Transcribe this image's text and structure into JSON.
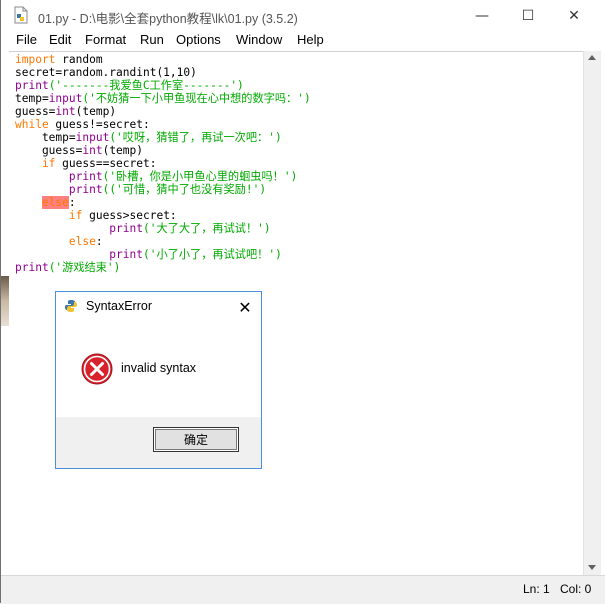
{
  "window": {
    "title": "01.py - D:\\电影\\全套python教程\\lk\\01.py (3.5.2)",
    "minimize_glyph": "—",
    "maximize_glyph": "☐",
    "close_glyph": "✕"
  },
  "menu": [
    "File",
    "Edit",
    "Format",
    "Run",
    "Options",
    "Window",
    "Help"
  ],
  "code_lines": [
    [
      {
        "t": "import",
        "c": "kw"
      },
      {
        "t": " random",
        "c": ""
      }
    ],
    [
      {
        "t": "secret=random.randint(1,10)",
        "c": ""
      }
    ],
    [
      {
        "t": "print",
        "c": "bi"
      },
      {
        "t": "('-------我爱鱼C工作室-------')",
        "c": "str"
      }
    ],
    [
      {
        "t": "temp=",
        "c": ""
      },
      {
        "t": "input",
        "c": "bi"
      },
      {
        "t": "('不妨猜一下小甲鱼现在心中想的数字吗：')",
        "c": "str"
      }
    ],
    [
      {
        "t": "guess=",
        "c": ""
      },
      {
        "t": "int",
        "c": "bi"
      },
      {
        "t": "(temp)",
        "c": ""
      }
    ],
    [
      {
        "t": "while",
        "c": "kw"
      },
      {
        "t": " guess!=secret:",
        "c": ""
      }
    ],
    [
      {
        "t": "    temp=",
        "c": ""
      },
      {
        "t": "input",
        "c": "bi"
      },
      {
        "t": "('哎呀，猜错了，再试一次吧：')",
        "c": "str"
      }
    ],
    [
      {
        "t": "    guess=",
        "c": ""
      },
      {
        "t": "int",
        "c": "bi"
      },
      {
        "t": "(temp)",
        "c": ""
      }
    ],
    [
      {
        "t": "    ",
        "c": ""
      },
      {
        "t": "if",
        "c": "kw"
      },
      {
        "t": " guess==secret:",
        "c": ""
      }
    ],
    [
      {
        "t": "        ",
        "c": ""
      },
      {
        "t": "print",
        "c": "bi"
      },
      {
        "t": "('卧槽，你是小甲鱼心里的蛔虫吗！')",
        "c": "str"
      }
    ],
    [
      {
        "t": "        ",
        "c": ""
      },
      {
        "t": "print",
        "c": "bi"
      },
      {
        "t": "(('可惜，猜中了也没有奖励!')",
        "c": "str"
      }
    ],
    [
      {
        "t": "    ",
        "c": ""
      },
      {
        "t": "else",
        "c": "hl"
      },
      {
        "t": ":",
        "c": ""
      }
    ],
    [
      {
        "t": "        ",
        "c": ""
      },
      {
        "t": "if",
        "c": "kw"
      },
      {
        "t": " guess>secret:",
        "c": ""
      }
    ],
    [
      {
        "t": "              ",
        "c": ""
      },
      {
        "t": "print",
        "c": "bi"
      },
      {
        "t": "('大了大了，再试试！')",
        "c": "str"
      }
    ],
    [
      {
        "t": "        ",
        "c": ""
      },
      {
        "t": "else",
        "c": "kw"
      },
      {
        "t": ":",
        "c": ""
      }
    ],
    [
      {
        "t": "              ",
        "c": ""
      },
      {
        "t": "print",
        "c": "bi"
      },
      {
        "t": "('小了小了，再试试吧！')",
        "c": "str"
      }
    ],
    [
      {
        "t": "print",
        "c": "bi"
      },
      {
        "t": "('游戏结束')",
        "c": "str"
      }
    ]
  ],
  "status": {
    "line": "Ln: 1",
    "col": "Col: 0"
  },
  "dialog": {
    "title": "SyntaxError",
    "message": "invalid syntax",
    "ok_label": "确定",
    "close_glyph": "✕"
  },
  "colors": {
    "keyword": "#ff7700",
    "builtin": "#900090",
    "string": "#00aa00",
    "error_highlight": "#ff8080",
    "dialog_border": "#4a8fd8",
    "error_icon": "#d9232c"
  },
  "icons": {
    "app": "python-file-icon",
    "dialog": "python-icon",
    "error": "error-x-icon"
  }
}
